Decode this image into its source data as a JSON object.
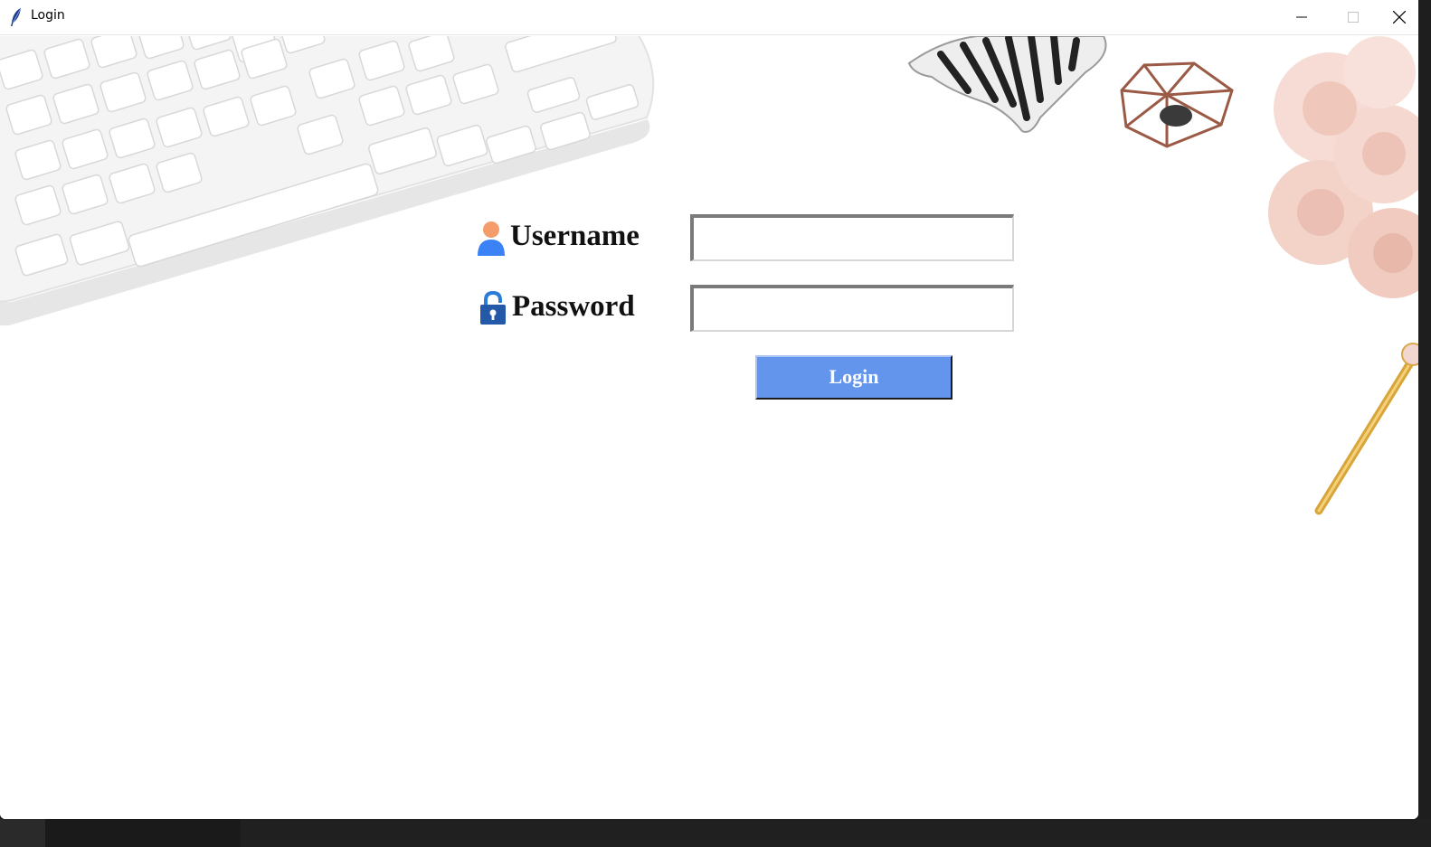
{
  "window": {
    "title": "Login",
    "controls": {
      "minimize": "minimize-icon",
      "maximize": "maximize-icon",
      "close": "close-icon"
    }
  },
  "form": {
    "username": {
      "label": "Username",
      "icon": "user-icon",
      "value": ""
    },
    "password": {
      "label": "Password",
      "icon": "lock-icon",
      "value": ""
    },
    "submit_label": "Login"
  },
  "colors": {
    "button_bg": "#6495ed",
    "button_text": "#ffffff",
    "label_text": "#111111",
    "window_bg": "#ffffff"
  }
}
